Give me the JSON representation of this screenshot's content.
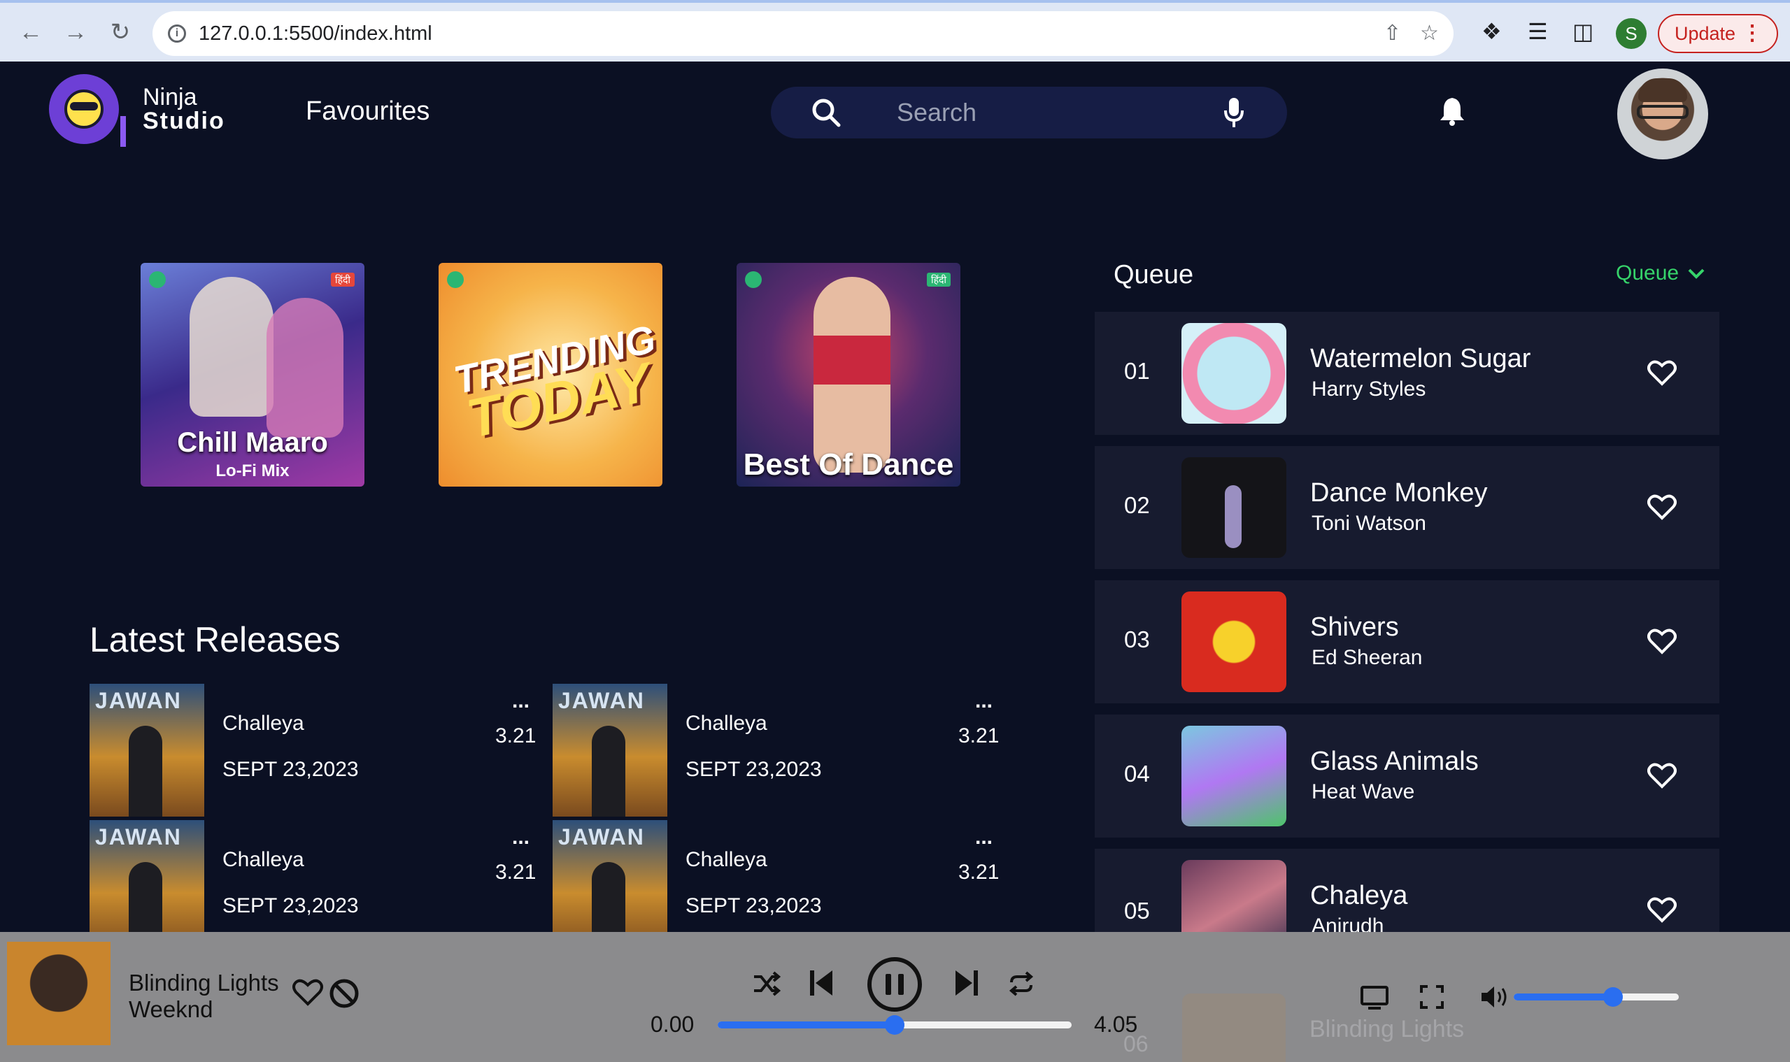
{
  "browser": {
    "url": "127.0.0.1:5500/index.html",
    "profile_initial": "S",
    "update_label": "Update"
  },
  "header": {
    "logo_line1": "Ninja",
    "logo_line2": "Studio",
    "favourites": "Favourites",
    "search_placeholder": "Search"
  },
  "playlists": [
    {
      "title": "Chill Maaro",
      "subtitle": "Lo-Fi Mix",
      "badge": "हिंदी"
    },
    {
      "title_line1": "TRENDING",
      "title_line2": "TODAY"
    },
    {
      "title": "Best Of Dance",
      "badge": "हिंदी"
    }
  ],
  "latest": {
    "title": "Latest Releases",
    "items": [
      {
        "name": "Challeya",
        "date": "SEPT 23,2023",
        "more": "...",
        "duration": "3.21"
      },
      {
        "name": "Challeya",
        "date": "SEPT 23,2023",
        "more": "...",
        "duration": "3.21"
      },
      {
        "name": "Challeya",
        "date": "SEPT 23,2023",
        "more": "...",
        "duration": "3.21"
      },
      {
        "name": "Challeya",
        "date": "SEPT 23,2023",
        "more": "...",
        "duration": "3.21"
      }
    ]
  },
  "queue": {
    "title": "Queue",
    "toggle_label": "Queue",
    "items": [
      {
        "num": "01",
        "name": "Watermelon Sugar",
        "artist": "Harry Styles"
      },
      {
        "num": "02",
        "name": "Dance Monkey",
        "artist": "Toni Watson"
      },
      {
        "num": "03",
        "name": "Shivers",
        "artist": "Ed Sheeran"
      },
      {
        "num": "04",
        "name": "Glass Animals",
        "artist": "Heat Wave"
      },
      {
        "num": "05",
        "name": "Chaleya",
        "artist": "Anirudh"
      },
      {
        "num": "06",
        "name": "Blinding Lights",
        "artist": ""
      }
    ]
  },
  "player": {
    "song": "Blinding Lights",
    "artist": "Weeknd",
    "current_time": "0.00",
    "total_time": "4.05",
    "progress": 0.5,
    "volume": 0.6,
    "colors": {
      "accent": "#2a6ef0",
      "queue_toggle": "#36d36a",
      "background": "#0b1023"
    }
  }
}
